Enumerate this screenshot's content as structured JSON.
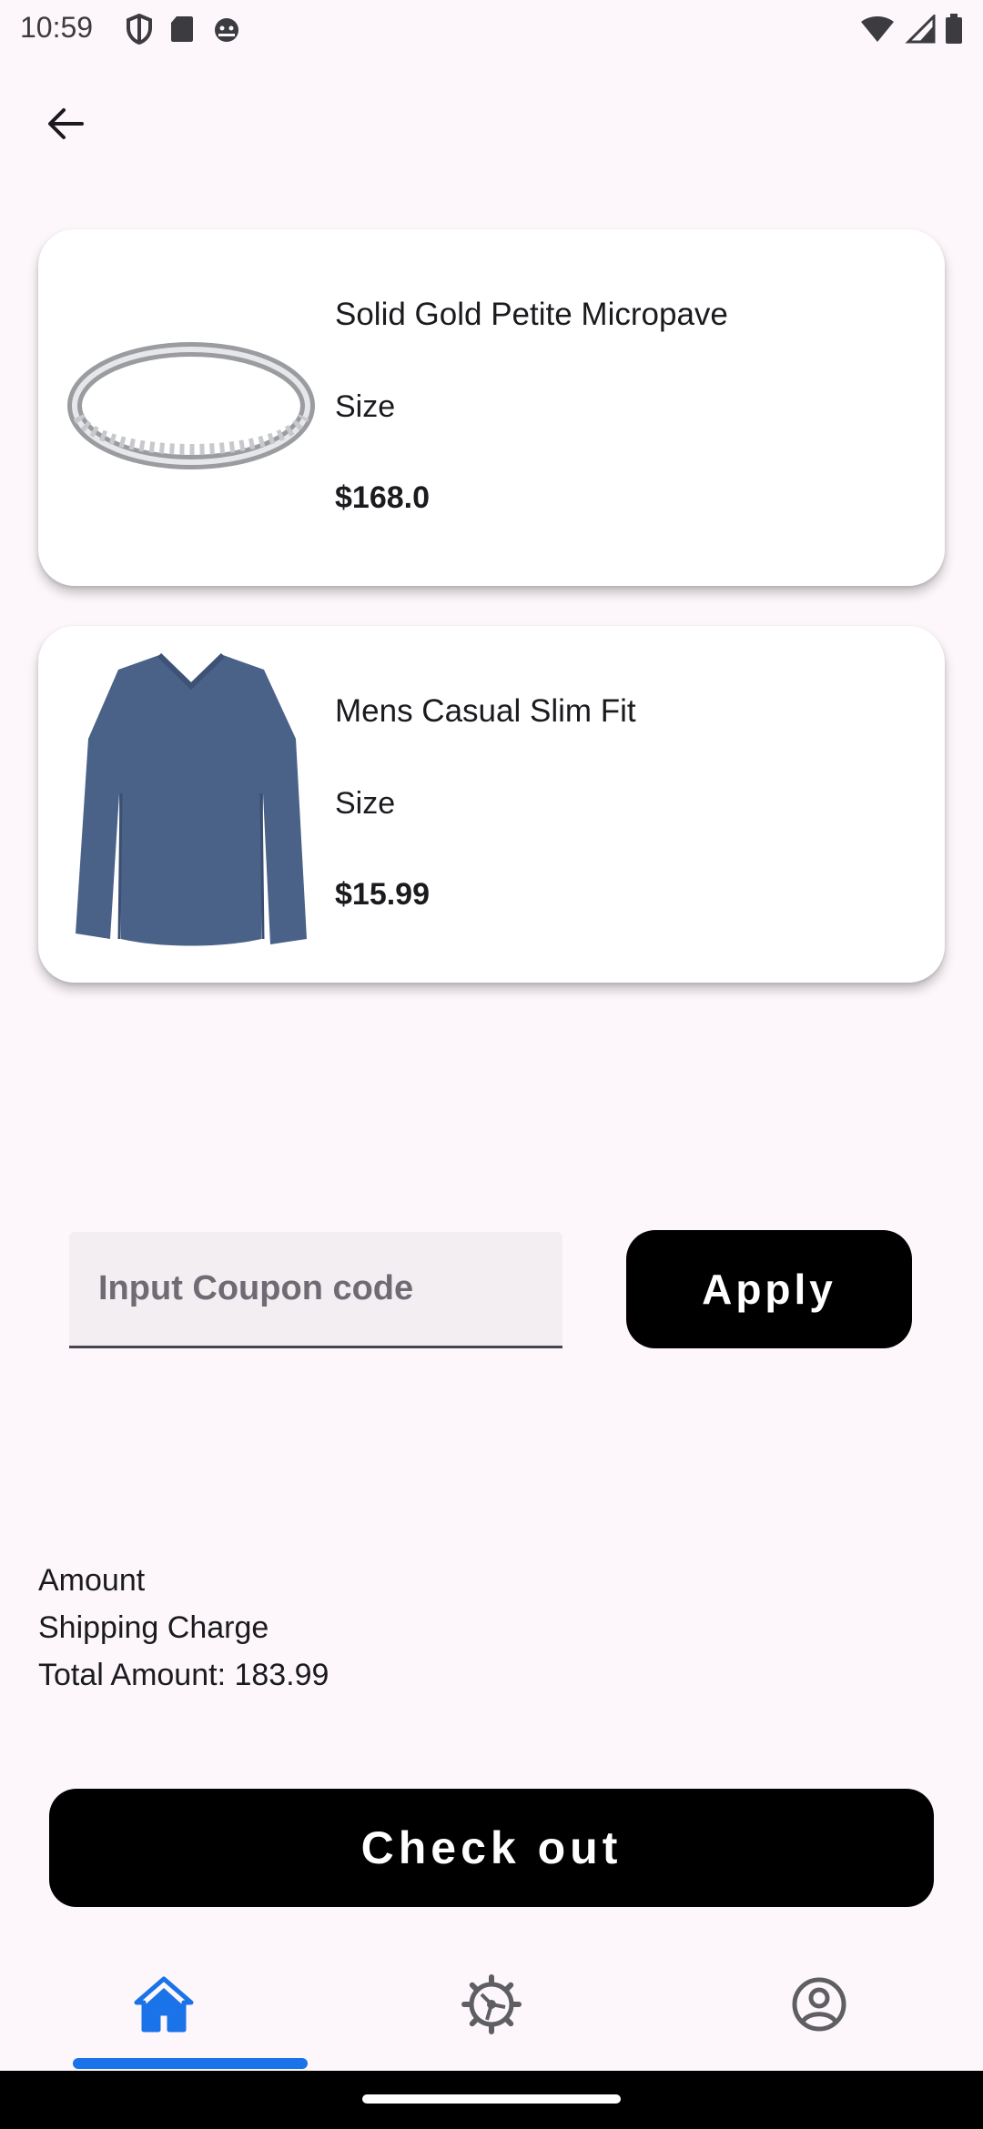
{
  "status_bar": {
    "time": "10:59",
    "left_icons": [
      "shield-icon",
      "sd-card-icon",
      "android-debug-icon"
    ],
    "right_icons": [
      "wifi-icon",
      "signal-icon",
      "battery-icon"
    ]
  },
  "header": {
    "back_icon": "arrow-back-icon"
  },
  "cart": {
    "items": [
      {
        "name": "Solid Gold Petite Micropave",
        "size_label": "Size",
        "price": "$168.0",
        "image": "ring-image"
      },
      {
        "name": "Mens Casual Slim Fit",
        "size_label": "Size",
        "price": "$15.99",
        "image": "shirt-image"
      }
    ]
  },
  "coupon": {
    "placeholder": "Input Coupon code",
    "value": "",
    "apply_label": "Apply"
  },
  "summary": {
    "amount_label": "Amount",
    "shipping_label": "Shipping Charge",
    "total_text": "Total Amount: 183.99"
  },
  "checkout": {
    "label": "Check out"
  },
  "bottom_nav": {
    "items": [
      {
        "icon": "home-icon",
        "active": true
      },
      {
        "icon": "settings-icon",
        "active": false
      },
      {
        "icon": "account-icon",
        "active": false
      }
    ]
  },
  "colors": {
    "background": "#fdf7fb",
    "button": "#000000",
    "button_text": "#ffffff",
    "accent": "#1a73e8",
    "inactive_icon": "#5f5f63"
  }
}
